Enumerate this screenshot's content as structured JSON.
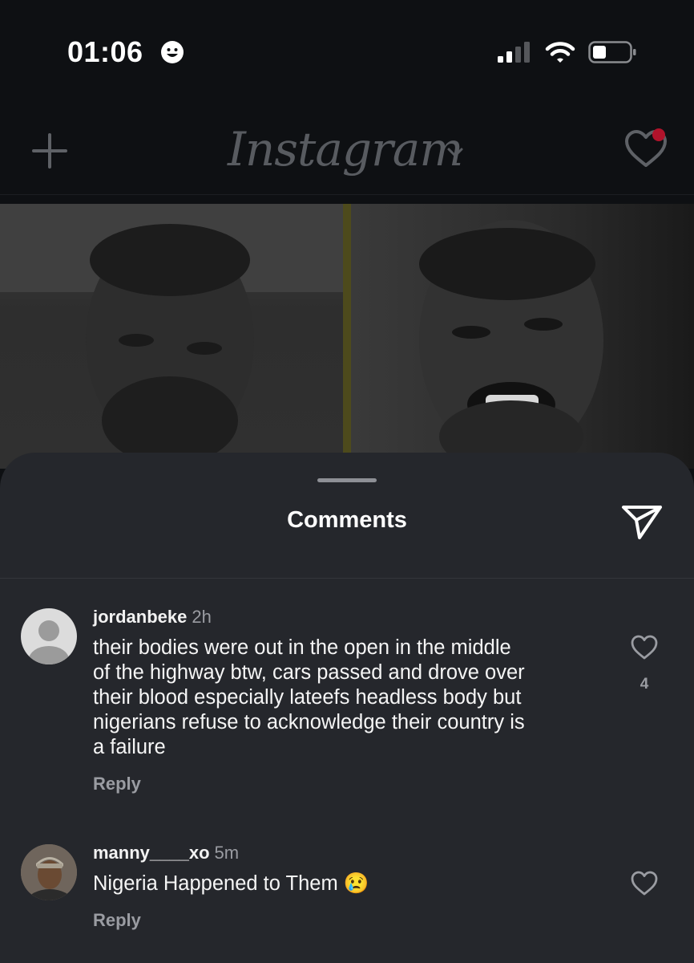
{
  "status_bar": {
    "time": "01:06",
    "smiley_icon": "smiley-face-icon",
    "signal_icon": "cellular-signal-icon",
    "wifi_icon": "wifi-icon",
    "battery_icon": "battery-icon"
  },
  "top_nav": {
    "logo_text": "Instagram",
    "new_post_icon": "plus-icon",
    "dropdown_icon": "chevron-down-icon",
    "activity_icon": "heart-icon",
    "notification_color": "#b0132b"
  },
  "comments_sheet": {
    "title": "Comments",
    "share_icon": "paper-plane-icon",
    "comments": [
      {
        "username": "jordanbeke",
        "time": "2h",
        "lines": [
          "their bodies were out in the open in the middle",
          "of the highway btw, cars passed and drove over",
          "their blood especially lateefs headless body but",
          "nigerians refuse to acknowledge their country is",
          "a failure"
        ],
        "reply_label": "Reply",
        "like_count": "4",
        "avatar_icon": "default-avatar-icon"
      },
      {
        "username": "manny____xo",
        "time": "5m",
        "lines": [
          "Nigeria Happened to Them 😢"
        ],
        "reply_label": "Reply",
        "avatar_icon": "user-photo-avatar"
      }
    ]
  }
}
